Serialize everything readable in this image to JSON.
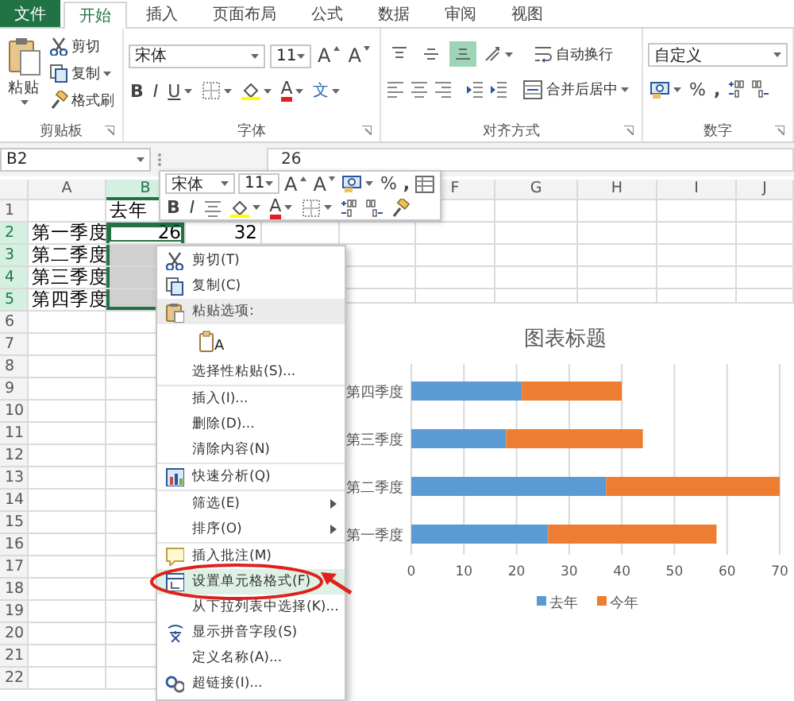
{
  "ribbon_tabs": [
    {
      "label": "文件",
      "kind": "file",
      "selected": false
    },
    {
      "label": "开始",
      "kind": "tab",
      "selected": true
    },
    {
      "label": "插入",
      "kind": "tab",
      "selected": false
    },
    {
      "label": "页面布局",
      "kind": "tab",
      "selected": false
    },
    {
      "label": "公式",
      "kind": "tab",
      "selected": false
    },
    {
      "label": "数据",
      "kind": "tab",
      "selected": false
    },
    {
      "label": "审阅",
      "kind": "tab",
      "selected": false
    },
    {
      "label": "视图",
      "kind": "tab",
      "selected": false
    }
  ],
  "clipboard_group": {
    "paste": "粘贴",
    "cut": "剪切",
    "copy": "复制",
    "format_painter": "格式刷",
    "label": "剪贴板"
  },
  "font_group": {
    "font_name": "宋体",
    "font_size": "11",
    "grow_glyph": "A",
    "shrink_glyph": "A",
    "bold": "B",
    "italic": "I",
    "underline": "U",
    "font_color_glyph": "A",
    "phonetic_glyph": "文",
    "label": "字体"
  },
  "alignment_group": {
    "vertical_align": [
      {
        "selected": false
      },
      {
        "selected": false
      },
      {
        "selected": true
      }
    ],
    "wrap_text": "自动换行",
    "merge_center": "合并后居中",
    "label": "对齐方式"
  },
  "number_group": {
    "format": "自定义",
    "percent": "%",
    "comma": ",",
    "label": "数字"
  },
  "formula_bar": {
    "name_box": "B2",
    "value": "26"
  },
  "mini_toolbar": {
    "font_name": "宋体",
    "font_size": "11",
    "grow_glyph": "A",
    "shrink_glyph": "A",
    "percent": "%",
    "comma": ",",
    "bold": "B",
    "italic": "I",
    "font_color_glyph": "A"
  },
  "sheet": {
    "column_headers_left": [
      "A",
      "B"
    ],
    "column_headers_right": [
      "F",
      "G",
      "H",
      "I",
      "J"
    ],
    "row_headers": [
      "1",
      "2",
      "3",
      "4",
      "5",
      "6",
      "7",
      "8",
      "9",
      "10",
      "11",
      "12",
      "13",
      "14",
      "15",
      "16",
      "17",
      "18",
      "19",
      "20",
      "21",
      "22"
    ],
    "rows": [
      [
        {
          "selected": false
        },
        {
          "text": "去年",
          "kind": "text",
          "selected": false
        }
      ],
      [
        {
          "text": "第一季度",
          "kind": "text",
          "selected": false
        },
        {
          "text": "26",
          "kind": "number",
          "selected": true,
          "active": true
        },
        {
          "text": "32",
          "kind": "number",
          "selected": false
        }
      ],
      [
        {
          "text": "第二季度",
          "kind": "text",
          "selected": false
        },
        {
          "selected": true
        }
      ],
      [
        {
          "text": "第三季度",
          "kind": "text",
          "selected": false
        },
        {
          "selected": true
        }
      ],
      [
        {
          "text": "第四季度",
          "kind": "text",
          "selected": false
        },
        {
          "selected": true
        }
      ]
    ]
  },
  "context_menu": [
    {
      "kind": "cut",
      "label": "剪切(T)",
      "selected": false,
      "circled": false,
      "divider_above": false
    },
    {
      "kind": "copy",
      "label": "复制(C)",
      "selected": false,
      "circled": false,
      "divider_above": false
    },
    {
      "kind": "paste-header",
      "label": "粘贴选项:",
      "selected": false,
      "circled": false,
      "divider_above": false
    },
    {
      "kind": "paste-option",
      "glyph": "A",
      "selected": false,
      "circled": false,
      "divider_above": false
    },
    {
      "kind": "plain",
      "label": "选择性粘贴(S)...",
      "selected": false,
      "circled": false,
      "divider_above": false
    },
    {
      "kind": "plain",
      "label": "插入(I)...",
      "selected": false,
      "circled": false,
      "divider_above": true
    },
    {
      "kind": "plain",
      "label": "删除(D)...",
      "selected": false,
      "circled": false,
      "divider_above": false
    },
    {
      "kind": "plain",
      "label": "清除内容(N)",
      "selected": false,
      "circled": false,
      "divider_above": false
    },
    {
      "kind": "analysis",
      "label": "快速分析(Q)",
      "selected": false,
      "circled": false,
      "divider_above": true
    },
    {
      "kind": "submenu",
      "label": "筛选(E)",
      "selected": false,
      "circled": false,
      "divider_above": true
    },
    {
      "kind": "submenu",
      "label": "排序(O)",
      "selected": false,
      "circled": false,
      "divider_above": false
    },
    {
      "kind": "comment",
      "label": "插入批注(M)",
      "selected": false,
      "circled": false,
      "divider_above": true
    },
    {
      "kind": "format",
      "label": "设置单元格格式(F)",
      "selected": true,
      "circled": true,
      "divider_above": false
    },
    {
      "kind": "plain",
      "label": "从下拉列表中选择(K)...",
      "selected": false,
      "circled": false,
      "divider_above": false
    },
    {
      "kind": "pinyin",
      "label": "显示拼音字段(S)",
      "selected": false,
      "circled": false,
      "divider_above": false
    },
    {
      "kind": "plain",
      "label": "定义名称(A)...",
      "selected": false,
      "circled": false,
      "divider_above": false
    },
    {
      "kind": "link",
      "label": "超链接(I)...",
      "selected": false,
      "circled": false,
      "divider_above": false
    }
  ],
  "chart": {
    "chart_data": {
      "type": "bar",
      "orientation": "horizontal",
      "stacked": true,
      "title": "图表标题",
      "categories": [
        "第四季度",
        "第三季度",
        "第二季度",
        "第一季度"
      ],
      "series": [
        {
          "name": "去年",
          "color": "#5b9bd5",
          "values": [
            21,
            18,
            37,
            26
          ]
        },
        {
          "name": "今年",
          "color": "#ed7d31",
          "values": [
            19,
            26,
            33,
            32
          ]
        }
      ],
      "xlim": [
        0,
        70
      ],
      "xticks": [
        0,
        10,
        20,
        30,
        40,
        50,
        60,
        70
      ],
      "grid": true,
      "legend": true
    }
  }
}
